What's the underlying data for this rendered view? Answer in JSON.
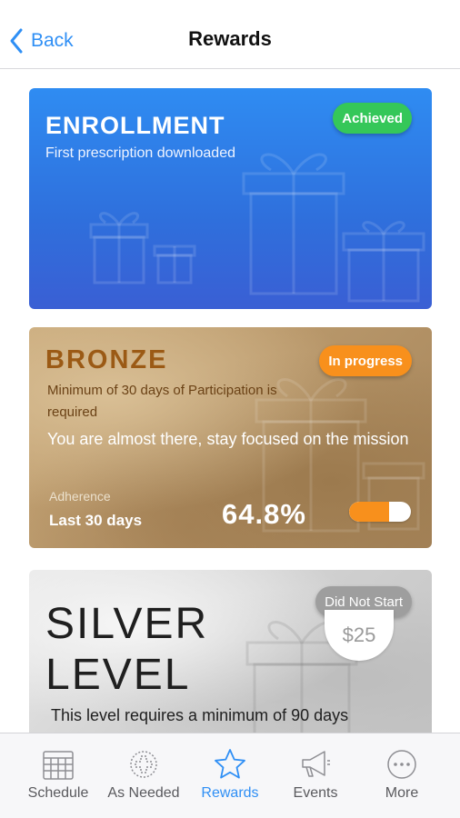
{
  "header": {
    "back_label": "Back",
    "title": "Rewards"
  },
  "cards": {
    "enrollment": {
      "title": "ENROLLMENT",
      "subtitle": "First prescription downloaded",
      "status": "Achieved"
    },
    "bronze": {
      "title": "BRONZE",
      "requirement": "Minimum of 30 days of Participation is required",
      "message": "You are almost there, stay focused on the mission",
      "status": "In progress",
      "adherence_label": "Adherence",
      "adherence_period": "Last 30 days",
      "adherence_value": "64.8%",
      "progress_fraction": 0.648
    },
    "silver": {
      "title": "SILVER LEVEL",
      "status": "Did Not Start",
      "prize": "$25",
      "requirement": "This level requires a minimum of 90 days"
    }
  },
  "tabbar": {
    "items": [
      {
        "label": "Schedule",
        "icon": "calendar-icon",
        "active": false
      },
      {
        "label": "As Needed",
        "icon": "pill-icon",
        "active": false
      },
      {
        "label": "Rewards",
        "icon": "star-icon",
        "active": true
      },
      {
        "label": "Events",
        "icon": "megaphone-icon",
        "active": false
      },
      {
        "label": "More",
        "icon": "more-icon",
        "active": false
      }
    ]
  },
  "colors": {
    "accent_blue": "#2f8ff5",
    "achieved_green": "#35c759",
    "in_progress_orange": "#f8901c",
    "not_started_gray": "#9e9e9e"
  }
}
